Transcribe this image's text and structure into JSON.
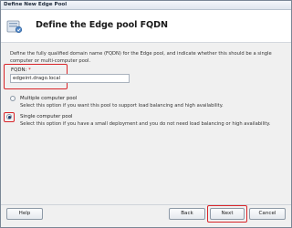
{
  "window": {
    "title": "Define New Edge Pool"
  },
  "header": {
    "title": "Define the Edge pool FQDN",
    "icon": "wizard-page-icon"
  },
  "main": {
    "description": "Define the fully qualified domain name (FQDN) for the Edge pool, and indicate whether this should be a single computer or multi-computer pool.",
    "fqdn": {
      "label": "FQDN:",
      "required_mark": "*",
      "value": "edgeint.drago.local"
    },
    "options": [
      {
        "label": "Multiple computer pool",
        "description": "Select this option if you want this pool to support load balancing and high availability.",
        "checked": false
      },
      {
        "label": "Single computer pool",
        "description": "Select this option if you have a small deployment and you do not need load balancing or high availability.",
        "checked": true
      }
    ]
  },
  "footer": {
    "help": "Help",
    "back": "Back",
    "next": "Next",
    "cancel": "Cancel"
  },
  "colors": {
    "highlight": "#d9252a",
    "accent": "#1d3f6e"
  }
}
